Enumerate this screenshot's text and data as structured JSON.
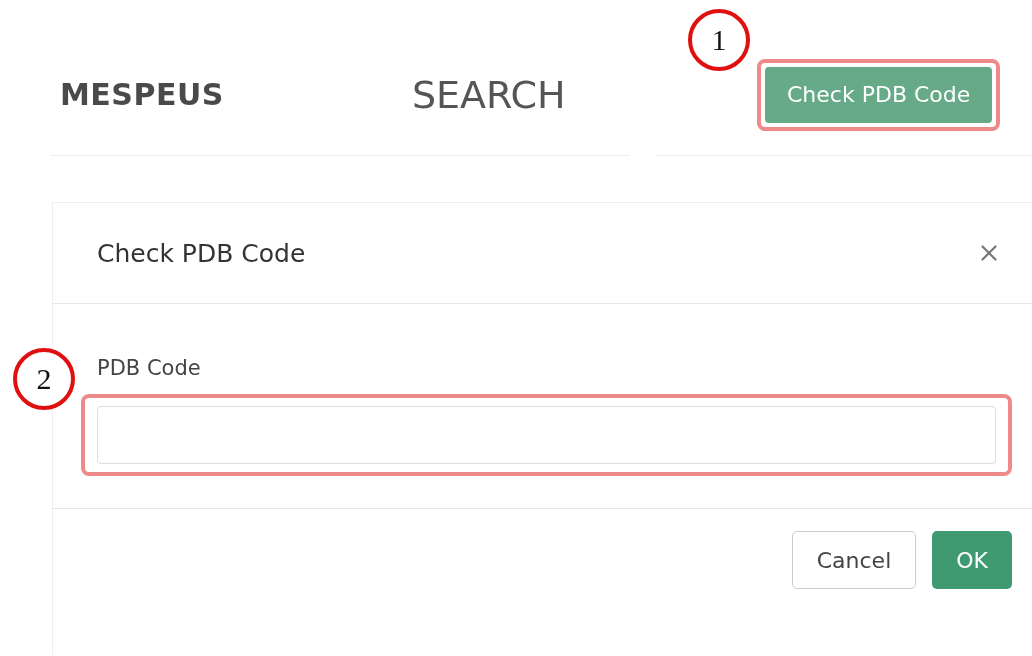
{
  "header": {
    "brand": "MESPEUS",
    "nav_link": "SEARCH",
    "action_button": "Check PDB Code"
  },
  "dialog": {
    "title": "Check PDB Code",
    "field": {
      "label": "PDB Code"
    },
    "buttons": [
      {
        "label": "Cancel",
        "kind": "secondary"
      },
      {
        "label": "OK",
        "kind": "primary"
      }
    ]
  },
  "callouts": [
    {
      "number": "1"
    },
    {
      "number": "2"
    }
  ]
}
